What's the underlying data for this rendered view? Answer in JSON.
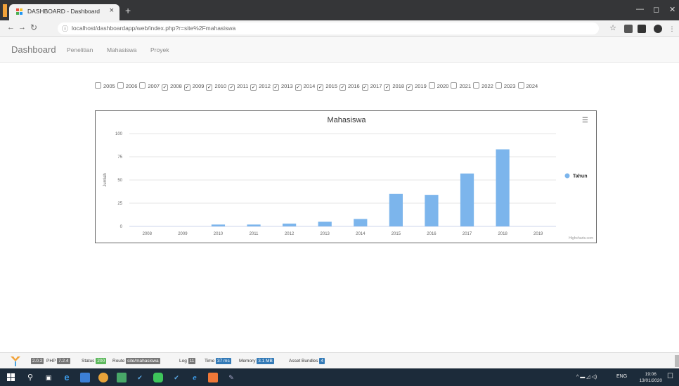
{
  "browser": {
    "tab_title": "DASHBOARD - Dashboard",
    "tab_close": "×",
    "new_tab": "+",
    "window_minimize": "—",
    "window_maximize": "◻",
    "window_close": "✕",
    "url": "localhost/dashboardapp/web/index.php?r=site%2Fmahasiswa"
  },
  "navbar": {
    "brand": "Dashboard",
    "links": [
      "Penelitian",
      "Mahasiswa",
      "Proyek"
    ]
  },
  "year_filter": [
    {
      "year": "2005",
      "checked": false
    },
    {
      "year": "2006",
      "checked": false
    },
    {
      "year": "2007",
      "checked": false
    },
    {
      "year": "2008",
      "checked": true
    },
    {
      "year": "2009",
      "checked": true
    },
    {
      "year": "2010",
      "checked": true
    },
    {
      "year": "2011",
      "checked": true
    },
    {
      "year": "2012",
      "checked": true
    },
    {
      "year": "2013",
      "checked": true
    },
    {
      "year": "2014",
      "checked": true
    },
    {
      "year": "2015",
      "checked": true
    },
    {
      "year": "2016",
      "checked": true
    },
    {
      "year": "2017",
      "checked": true
    },
    {
      "year": "2018",
      "checked": true
    },
    {
      "year": "2019",
      "checked": true
    },
    {
      "year": "2020",
      "checked": false
    },
    {
      "year": "2021",
      "checked": false
    },
    {
      "year": "2022",
      "checked": false
    },
    {
      "year": "2023",
      "checked": false
    },
    {
      "year": "2024",
      "checked": false
    }
  ],
  "chart_data": {
    "type": "bar",
    "title": "Mahasiswa",
    "xlabel": "",
    "ylabel": "Jumlah",
    "categories": [
      "2008",
      "2009",
      "2010",
      "2011",
      "2012",
      "2013",
      "2014",
      "2015",
      "2016",
      "2017",
      "2018",
      "2019"
    ],
    "series": [
      {
        "name": "Tahun",
        "values": [
          0,
          0,
          2,
          2,
          3,
          5,
          8,
          35,
          34,
          57,
          83,
          0
        ],
        "color": "#7cb5ec"
      }
    ],
    "ylim": [
      0,
      100
    ],
    "yticks": [
      0,
      25,
      50,
      75,
      100
    ],
    "grid": true,
    "legend": "right",
    "credits": "Highcharts.com"
  },
  "debug_toolbar": {
    "version": "2.0.2",
    "php_label": "PHP",
    "php_version": "7.2.4",
    "status_label": "Status",
    "status_value": "200",
    "route_label": "Route",
    "route_value": "site/mahasiswa",
    "log_label": "Log",
    "log_value": "11",
    "time_label": "Time",
    "time_value": "37 ms",
    "memory_label": "Memory",
    "memory_value": "3.1 MB",
    "asset_label": "Asset Bundles",
    "asset_value": "4",
    "colors": {
      "green": "#5cb85c",
      "blue": "#337ab7",
      "gray": "#777777"
    }
  },
  "taskbar": {
    "language": "ENG",
    "time": "19:06",
    "date": "13/01/2020"
  }
}
